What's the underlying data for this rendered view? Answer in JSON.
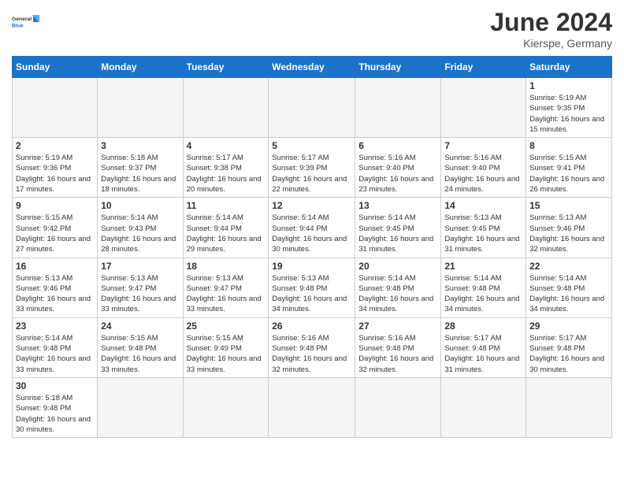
{
  "logo": {
    "line1": "General",
    "line2": "Blue"
  },
  "title": {
    "month_year": "June 2024",
    "location": "Kierspe, Germany"
  },
  "weekdays": [
    "Sunday",
    "Monday",
    "Tuesday",
    "Wednesday",
    "Thursday",
    "Friday",
    "Saturday"
  ],
  "weeks": [
    [
      {
        "day": "",
        "info": ""
      },
      {
        "day": "",
        "info": ""
      },
      {
        "day": "",
        "info": ""
      },
      {
        "day": "",
        "info": ""
      },
      {
        "day": "",
        "info": ""
      },
      {
        "day": "",
        "info": ""
      },
      {
        "day": "1",
        "info": "Sunrise: 5:19 AM\nSunset: 9:35 PM\nDaylight: 16 hours and 15 minutes."
      }
    ],
    [
      {
        "day": "2",
        "info": "Sunrise: 5:19 AM\nSunset: 9:36 PM\nDaylight: 16 hours and 17 minutes."
      },
      {
        "day": "3",
        "info": "Sunrise: 5:18 AM\nSunset: 9:37 PM\nDaylight: 16 hours and 18 minutes."
      },
      {
        "day": "4",
        "info": "Sunrise: 5:17 AM\nSunset: 9:38 PM\nDaylight: 16 hours and 20 minutes."
      },
      {
        "day": "5",
        "info": "Sunrise: 5:17 AM\nSunset: 9:39 PM\nDaylight: 16 hours and 22 minutes."
      },
      {
        "day": "6",
        "info": "Sunrise: 5:16 AM\nSunset: 9:40 PM\nDaylight: 16 hours and 23 minutes."
      },
      {
        "day": "7",
        "info": "Sunrise: 5:16 AM\nSunset: 9:40 PM\nDaylight: 16 hours and 24 minutes."
      },
      {
        "day": "8",
        "info": "Sunrise: 5:15 AM\nSunset: 9:41 PM\nDaylight: 16 hours and 26 minutes."
      }
    ],
    [
      {
        "day": "9",
        "info": "Sunrise: 5:15 AM\nSunset: 9:42 PM\nDaylight: 16 hours and 27 minutes."
      },
      {
        "day": "10",
        "info": "Sunrise: 5:14 AM\nSunset: 9:43 PM\nDaylight: 16 hours and 28 minutes."
      },
      {
        "day": "11",
        "info": "Sunrise: 5:14 AM\nSunset: 9:44 PM\nDaylight: 16 hours and 29 minutes."
      },
      {
        "day": "12",
        "info": "Sunrise: 5:14 AM\nSunset: 9:44 PM\nDaylight: 16 hours and 30 minutes."
      },
      {
        "day": "13",
        "info": "Sunrise: 5:14 AM\nSunset: 9:45 PM\nDaylight: 16 hours and 31 minutes."
      },
      {
        "day": "14",
        "info": "Sunrise: 5:13 AM\nSunset: 9:45 PM\nDaylight: 16 hours and 31 minutes."
      },
      {
        "day": "15",
        "info": "Sunrise: 5:13 AM\nSunset: 9:46 PM\nDaylight: 16 hours and 32 minutes."
      }
    ],
    [
      {
        "day": "16",
        "info": "Sunrise: 5:13 AM\nSunset: 9:46 PM\nDaylight: 16 hours and 33 minutes."
      },
      {
        "day": "17",
        "info": "Sunrise: 5:13 AM\nSunset: 9:47 PM\nDaylight: 16 hours and 33 minutes."
      },
      {
        "day": "18",
        "info": "Sunrise: 5:13 AM\nSunset: 9:47 PM\nDaylight: 16 hours and 33 minutes."
      },
      {
        "day": "19",
        "info": "Sunrise: 5:13 AM\nSunset: 9:48 PM\nDaylight: 16 hours and 34 minutes."
      },
      {
        "day": "20",
        "info": "Sunrise: 5:14 AM\nSunset: 9:48 PM\nDaylight: 16 hours and 34 minutes."
      },
      {
        "day": "21",
        "info": "Sunrise: 5:14 AM\nSunset: 9:48 PM\nDaylight: 16 hours and 34 minutes."
      },
      {
        "day": "22",
        "info": "Sunrise: 5:14 AM\nSunset: 9:48 PM\nDaylight: 16 hours and 34 minutes."
      }
    ],
    [
      {
        "day": "23",
        "info": "Sunrise: 5:14 AM\nSunset: 9:48 PM\nDaylight: 16 hours and 33 minutes."
      },
      {
        "day": "24",
        "info": "Sunrise: 5:15 AM\nSunset: 9:48 PM\nDaylight: 16 hours and 33 minutes."
      },
      {
        "day": "25",
        "info": "Sunrise: 5:15 AM\nSunset: 9:49 PM\nDaylight: 16 hours and 33 minutes."
      },
      {
        "day": "26",
        "info": "Sunrise: 5:16 AM\nSunset: 9:48 PM\nDaylight: 16 hours and 32 minutes."
      },
      {
        "day": "27",
        "info": "Sunrise: 5:16 AM\nSunset: 9:48 PM\nDaylight: 16 hours and 32 minutes."
      },
      {
        "day": "28",
        "info": "Sunrise: 5:17 AM\nSunset: 9:48 PM\nDaylight: 16 hours and 31 minutes."
      },
      {
        "day": "29",
        "info": "Sunrise: 5:17 AM\nSunset: 9:48 PM\nDaylight: 16 hours and 30 minutes."
      }
    ],
    [
      {
        "day": "30",
        "info": "Sunrise: 5:18 AM\nSunset: 9:48 PM\nDaylight: 16 hours and 30 minutes."
      },
      {
        "day": "",
        "info": ""
      },
      {
        "day": "",
        "info": ""
      },
      {
        "day": "",
        "info": ""
      },
      {
        "day": "",
        "info": ""
      },
      {
        "day": "",
        "info": ""
      },
      {
        "day": "",
        "info": ""
      }
    ]
  ]
}
